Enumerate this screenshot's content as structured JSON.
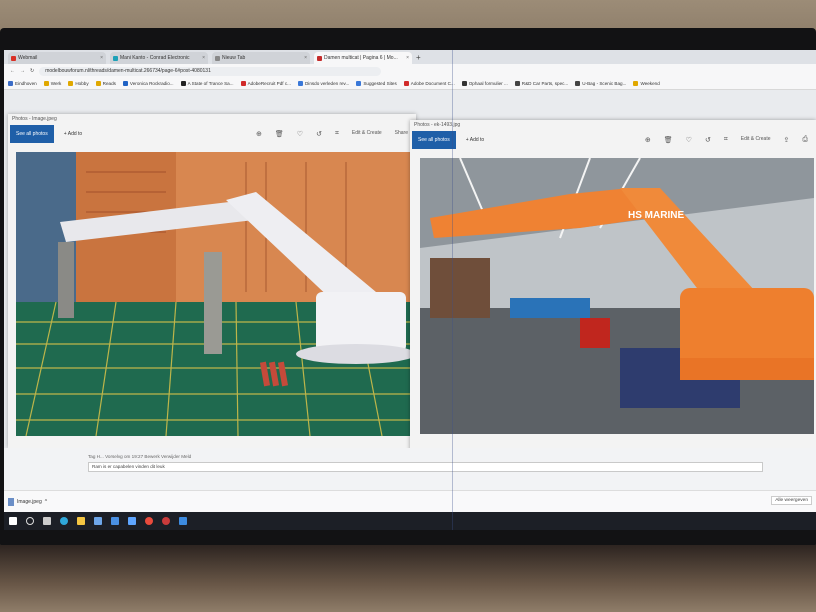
{
  "browser": {
    "tabs": [
      {
        "label": "Webmail",
        "color": "#d93025"
      },
      {
        "label": "Mani Kanto - Conrad Electronic",
        "color": "#1da1b8"
      },
      {
        "label": "Nieuw Tab",
        "color": "#888888"
      },
      {
        "label": "Damen multicat | Pagina 6 | Mo...",
        "color": "#c42b2b"
      }
    ],
    "new_tab": "+",
    "url": "modelbouwforum.nl/threads/damen-multicat.266734/page-6#post-4080131",
    "bookmarks": [
      {
        "label": "Eindhoven",
        "color": "#3b6cc7"
      },
      {
        "label": "Werk",
        "color": "#e0a800"
      },
      {
        "label": "Hobby",
        "color": "#e0a800"
      },
      {
        "label": "Reads",
        "color": "#e0a800"
      },
      {
        "label": "Veronica Rockradio...",
        "color": "#2062c4"
      },
      {
        "label": "A State of Trance Sa...",
        "color": "#222222"
      },
      {
        "label": "AdobeRecruit Pdf c...",
        "color": "#d12a2a"
      },
      {
        "label": "Dinsdo verleden rev...",
        "color": "#3a78d8"
      },
      {
        "label": "Suggested Sites",
        "color": "#3a78d8"
      },
      {
        "label": "Adobe Document C...",
        "color": "#d12a2a"
      },
      {
        "label": "Ophaal formulier ...",
        "color": "#333333"
      },
      {
        "label": "R&D Car Parts, spec...",
        "color": "#444444"
      },
      {
        "label": "U-Bag - Scenic Bag...",
        "color": "#444444"
      },
      {
        "label": "Weekend",
        "color": "#e0a800"
      }
    ]
  },
  "photos_left": {
    "title": "Photos - Image.jpeg",
    "see_all": "See all photos",
    "add_to": "Add to",
    "edit_create": "Edit & Create",
    "share": "Share"
  },
  "photos_right": {
    "title": "Photos - ek-1493.jpg",
    "see_all": "See all photos",
    "add_to": "Add to",
    "edit_create": "Edit & Create"
  },
  "page": {
    "reply_meta": "Tag H... Vorselvg om 19:27  Bewerk  Verwijder  Meld",
    "reply_field": "Ram is er capabelen vinden dit leuk",
    "download_file": "Image.jpeg",
    "show_all": "Alle weergeven"
  },
  "taskbar": {
    "icons": [
      {
        "name": "windows-start-icon",
        "color": "#ffffff"
      },
      {
        "name": "task-view-icon",
        "color": "#cccccc"
      },
      {
        "name": "edge-icon",
        "color": "#2fa7d9"
      },
      {
        "name": "file-explorer-icon",
        "color": "#f4c542"
      },
      {
        "name": "store-icon",
        "color": "#6ea6e8"
      },
      {
        "name": "mail-icon",
        "color": "#4a90e2"
      },
      {
        "name": "photos-icon",
        "color": "#5fa6ff"
      },
      {
        "name": "chrome-icon",
        "color": "#e94b3c"
      },
      {
        "name": "app-icon",
        "color": "#c93b3b"
      },
      {
        "name": "photos-app-icon",
        "color": "#3d8be0"
      }
    ]
  }
}
